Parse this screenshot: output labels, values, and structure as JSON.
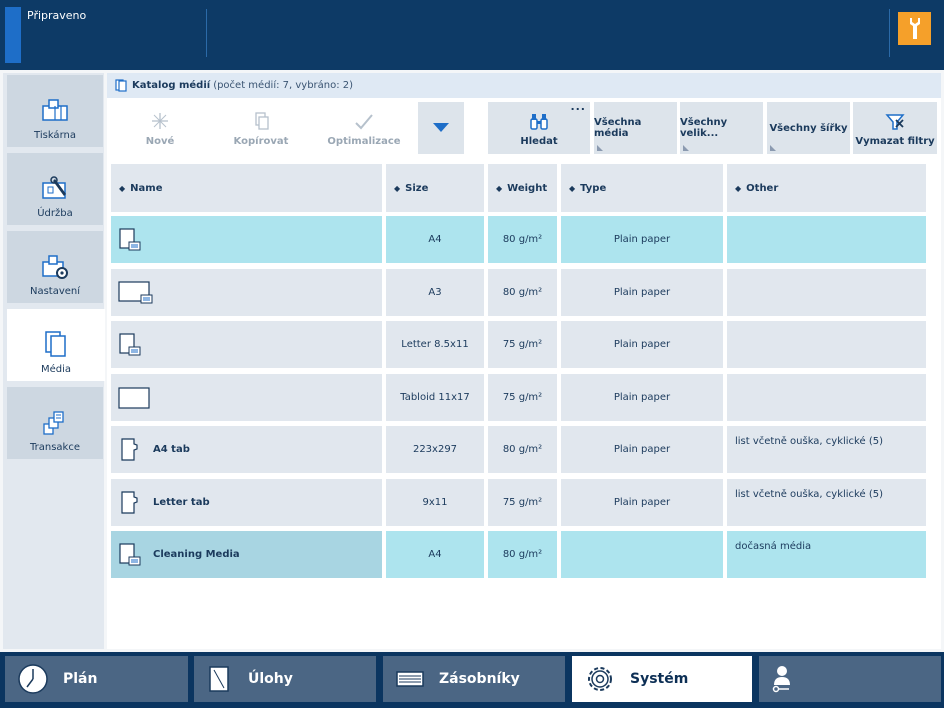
{
  "header": {
    "status": "Připraveno"
  },
  "leftnav": {
    "items": [
      {
        "label": "Tiskárna"
      },
      {
        "label": "Údržba"
      },
      {
        "label": "Nastavení"
      },
      {
        "label": "Média"
      },
      {
        "label": "Transakce"
      }
    ]
  },
  "catalog": {
    "title": "Katalog médií",
    "subtitle": "(počet médií: 7, vybráno: 2)"
  },
  "toolbar": {
    "new_label": "Nové",
    "copy_label": "Kopírovat",
    "optimize_label": "Optimalizace",
    "search_label": "Hledat",
    "more_label": "...",
    "filters": [
      "Všechna média",
      "Všechny velik...",
      "Všechny šířky"
    ],
    "clear_filters_label": "Vymazat filtry"
  },
  "table": {
    "columns": [
      "Name",
      "Size",
      "Weight",
      "Type",
      "Other"
    ],
    "rows": [
      {
        "name": "",
        "size": "A4",
        "weight": "80 g/m²",
        "type": "Plain paper",
        "other": ""
      },
      {
        "name": "",
        "size": "A3",
        "weight": "80 g/m²",
        "type": "Plain paper",
        "other": ""
      },
      {
        "name": "",
        "size": "Letter 8.5x11",
        "weight": "75 g/m²",
        "type": "Plain paper",
        "other": ""
      },
      {
        "name": "",
        "size": "Tabloid 11x17",
        "weight": "75 g/m²",
        "type": "Plain paper",
        "other": ""
      },
      {
        "name": "A4 tab",
        "size": "223x297",
        "weight": "80 g/m²",
        "type": "Plain paper",
        "other": "list včetně ouška, cyklické (5)"
      },
      {
        "name": "Letter tab",
        "size": "9x11",
        "weight": "75 g/m²",
        "type": "Plain paper",
        "other": "list včetně ouška, cyklické (5)"
      },
      {
        "name": "Cleaning Media",
        "size": "A4",
        "weight": "80 g/m²",
        "type": "",
        "other": "dočasná média"
      }
    ]
  },
  "bottombar": {
    "tabs": [
      {
        "label": "Plán"
      },
      {
        "label": "Úlohy"
      },
      {
        "label": "Zásobníky"
      },
      {
        "label": "Systém"
      },
      {
        "label": ""
      }
    ]
  },
  "colors": {
    "header_bg": "#0d3a66",
    "accent": "#1e6ec8",
    "tool_button": "#f5a02a",
    "selected_row": "#ade4ee",
    "cell_bg": "#e1e7ee",
    "tab_bg": "#4b6684"
  }
}
